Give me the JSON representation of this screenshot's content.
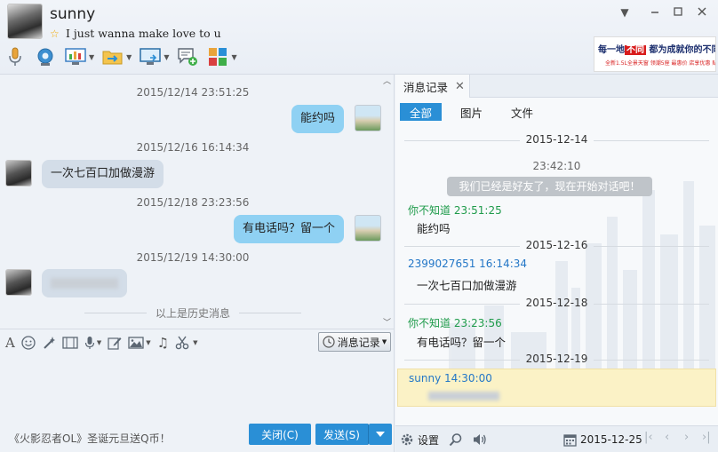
{
  "contact": {
    "name": "sunny",
    "signature": "I just wanna make love to u"
  },
  "ad": {
    "line1_a": "每一地",
    "line1_b": "不同",
    "line1_c": "都为成就你的不同",
    "line2": "全新1.5L全景天窗 领潮5座 最惠价 店享优惠 贴合城"
  },
  "chat": {
    "messages": [
      {
        "time": "2015/12/14 23:51:25",
        "side": "me",
        "text": "能约吗"
      },
      {
        "time": "2015/12/16 16:14:34",
        "side": "them",
        "text": "一次七百口加做漫游"
      },
      {
        "time": "2015/12/18 23:23:56",
        "side": "me",
        "text": "有电话吗？留一个"
      },
      {
        "time": "2015/12/19 14:30:00",
        "side": "them",
        "text": ""
      }
    ],
    "history_divider": "以上是历史消息"
  },
  "input": {
    "history_button": "消息记录",
    "promo": "《火影忍者OL》圣诞元旦送Q币！",
    "close_button": "关闭(C)",
    "send_button": "发送(S)"
  },
  "record": {
    "tab_label": "消息记录",
    "filters": [
      "全部",
      "图片",
      "文件"
    ],
    "date1": "2015-12-14",
    "time1": "23:42:10",
    "system_msg": "我们已经是好友了，现在开始对话吧！",
    "entry1_sender": "你不知道 23:51:25",
    "entry1_text": "能约吗",
    "date2": "2015-12-16",
    "entry2_sender": "2399027651 16:14:34",
    "entry2_text": "一次七百口加做漫游",
    "date3": "2015-12-18",
    "entry3_sender": "你不知道 23:23:56",
    "entry3_text": "有电话吗？留一个",
    "date4": "2015-12-19",
    "entry4_sender": "sunny 14:30:00",
    "footer_settings": "设置",
    "footer_date": "2015-12-25"
  },
  "colors": {
    "accent": "#2a8fd6",
    "bubble_me": "#8fd1f3",
    "bubble_them": "#d3dde8",
    "highlight": "#fbf2c6",
    "sender_green": "#1f9b4b",
    "sender_blue": "#2477c7"
  }
}
